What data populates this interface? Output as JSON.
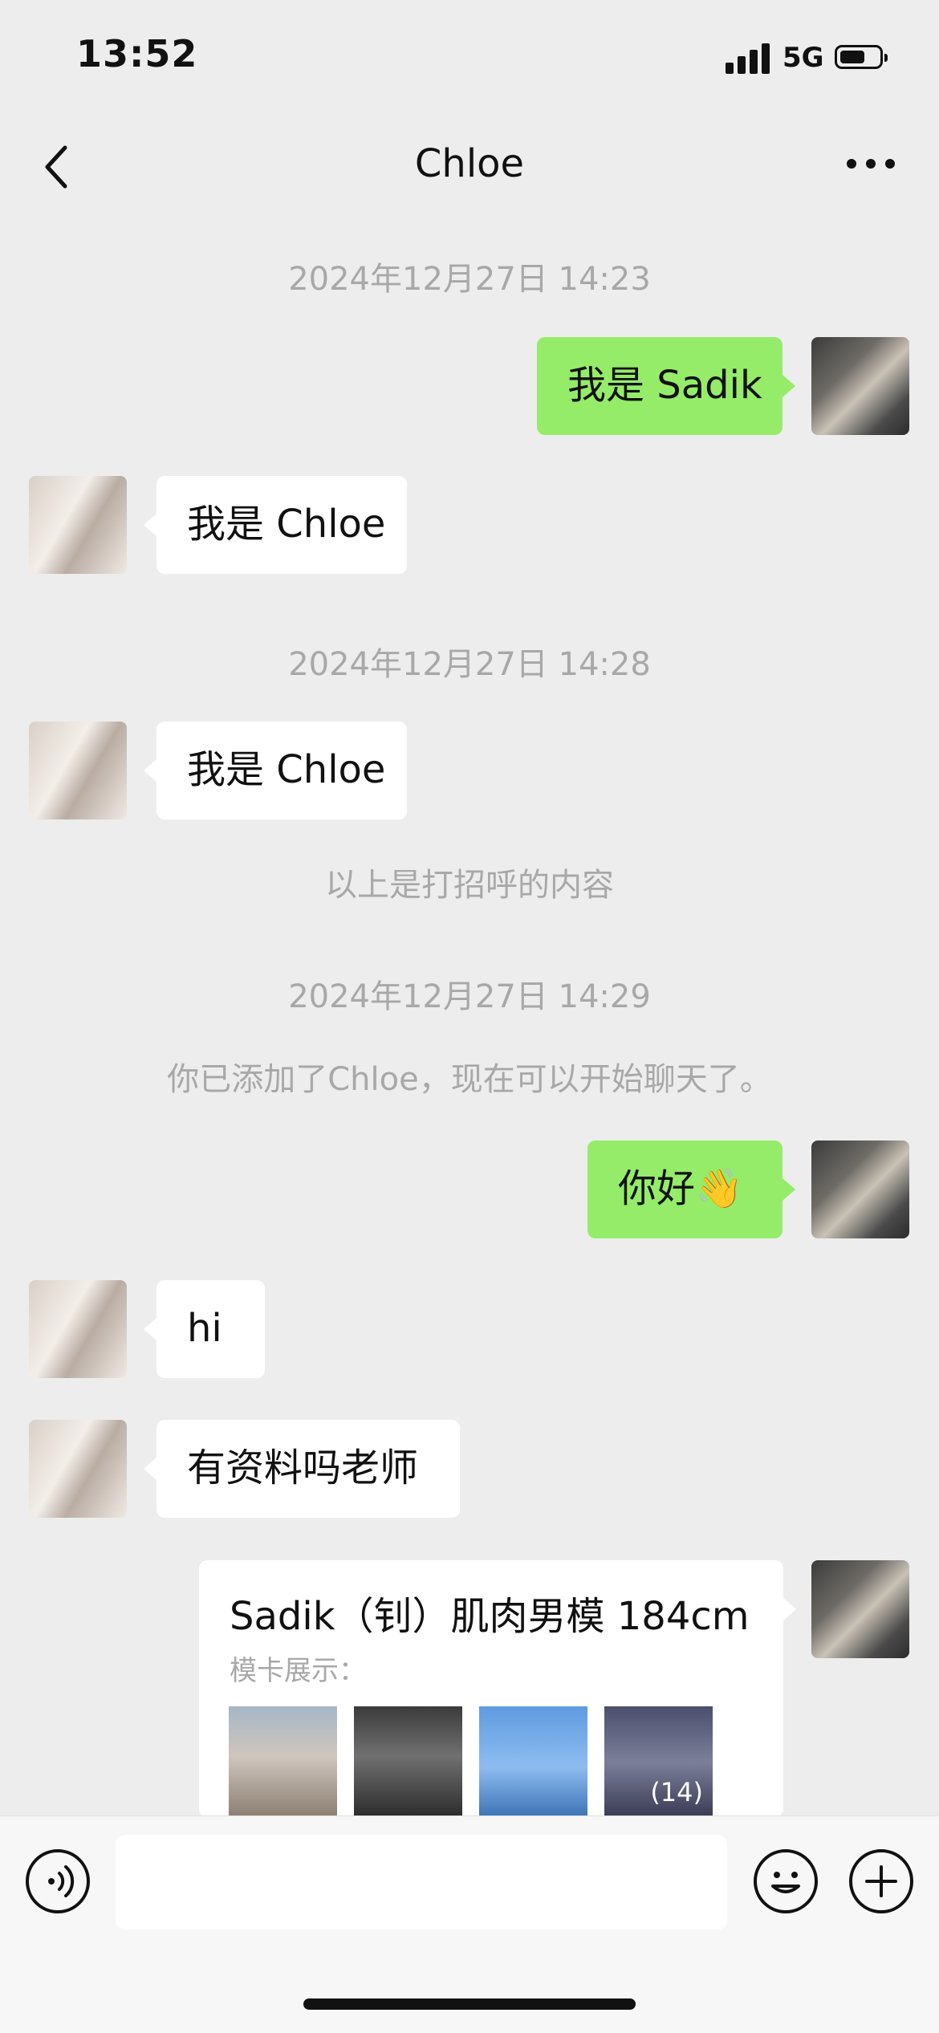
{
  "status_bar": {
    "time": "13:52",
    "network": "5G",
    "battery_level": 0.65
  },
  "nav": {
    "title": "Chloe"
  },
  "messages": {
    "ts1": "2024年12月27日 14:23",
    "m1": "我是 Sadik",
    "m2": "我是 Chloe",
    "ts2": "2024年12月27日 14:28",
    "m3": "我是 Chloe",
    "greeting_note": "以上是打招呼的内容",
    "ts3": "2024年12月27日 14:29",
    "added_note": "你已添加了Chloe，现在可以开始聊天了。",
    "m4": "你好👋",
    "m5": "hi",
    "m6": "有资料吗老师"
  },
  "card": {
    "title": "Sadik（钊）肌肉男模 184cm",
    "subtitle": "模卡展示：",
    "photo_count": "(14)"
  },
  "icons": {
    "back": "chevron-left-icon",
    "more": "more-dots-icon",
    "voice": "voice-icon",
    "emoji": "emoji-icon",
    "plus": "plus-icon"
  },
  "colors": {
    "background": "#ededed",
    "sent_bubble": "#95ec69",
    "received_bubble": "#ffffff",
    "system_text": "#a8a8a8"
  }
}
